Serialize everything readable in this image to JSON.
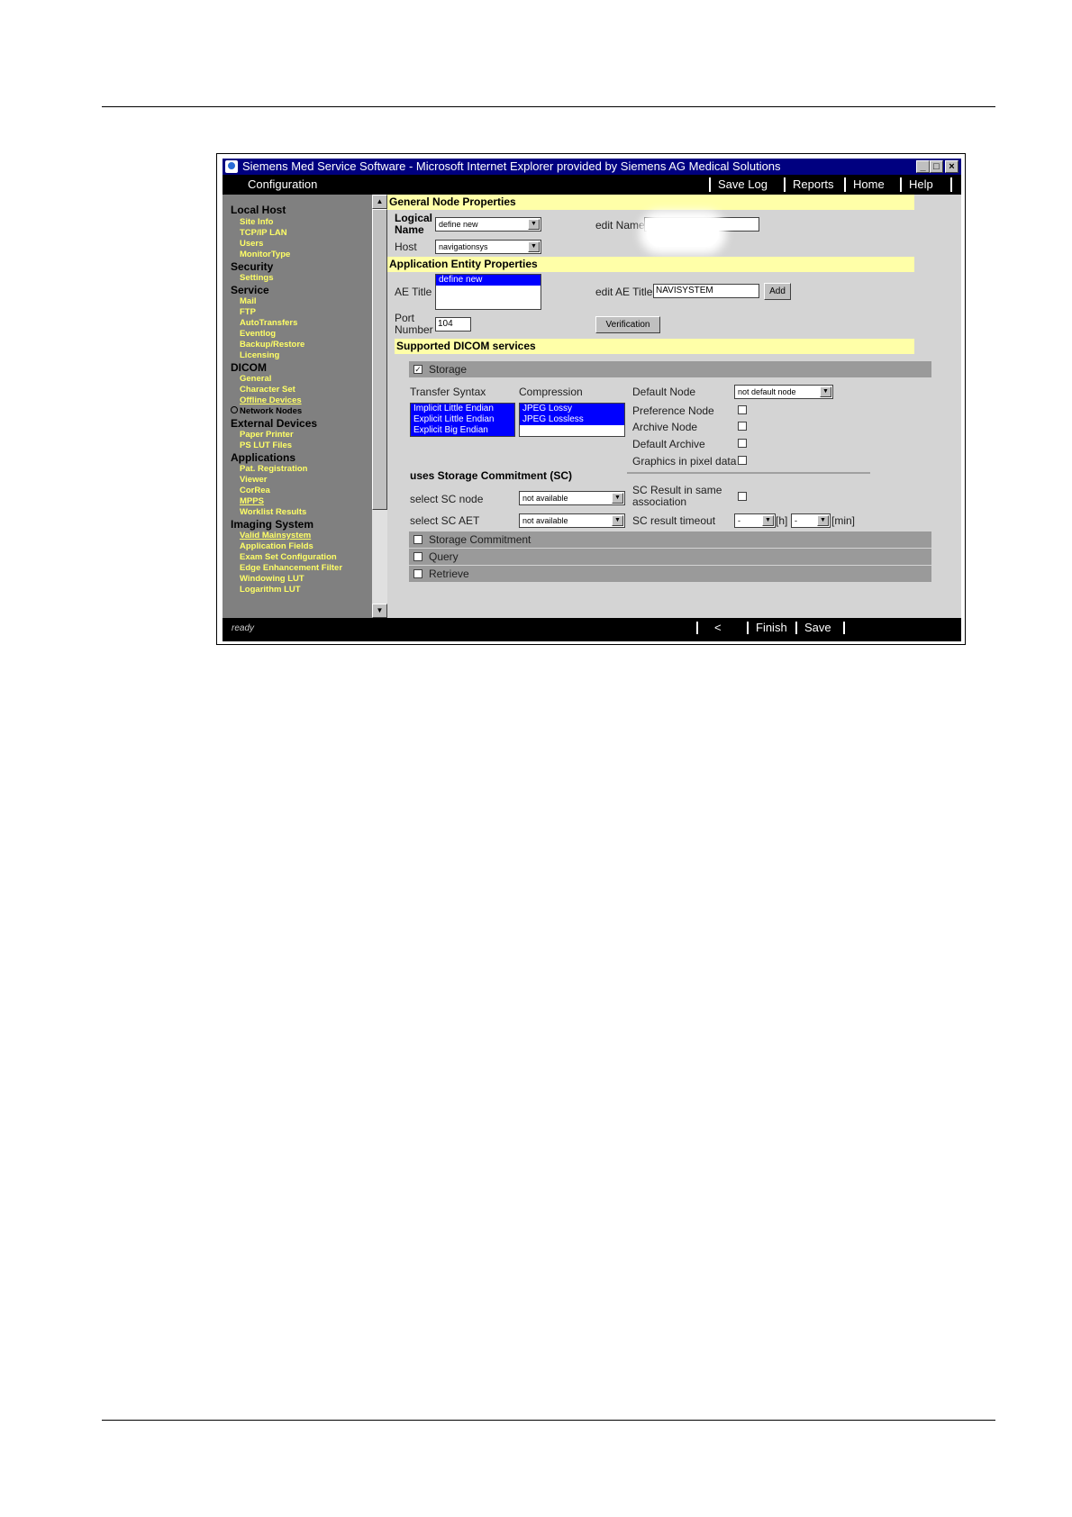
{
  "window": {
    "title": "Siemens Med Service Software - Microsoft Internet Explorer provided by Siemens AG Medical Solutions",
    "min": "_",
    "max": "□",
    "close": "×"
  },
  "topnav": {
    "section": "Configuration",
    "links": [
      "Save Log",
      "Reports",
      "Home",
      "Help"
    ]
  },
  "sidebar": {
    "groups": [
      {
        "title": "Local Host",
        "items": [
          "Site Info",
          "TCP/IP LAN",
          "Users",
          "MonitorType"
        ]
      },
      {
        "title": "Security",
        "items": [
          "Settings"
        ]
      },
      {
        "title": "Service",
        "items": [
          "Mail",
          "FTP",
          "AutoTransfers",
          "Eventlog",
          "Backup/Restore",
          "Licensing"
        ]
      },
      {
        "title": "DICOM",
        "items": [
          "General",
          "Character Set",
          "Offline Devices",
          "Network Nodes"
        ]
      },
      {
        "title": "External Devices",
        "items": [
          "Paper Printer",
          "PS LUT Files"
        ]
      },
      {
        "title": "Applications",
        "items": [
          "Pat. Registration",
          "Viewer",
          "CorRea",
          "MPPS",
          "Worklist Results"
        ]
      },
      {
        "title": "Imaging System",
        "items": [
          "Valid Mainsystem",
          "Application Fields",
          "Exam Set Configuration",
          "Edge Enhancement Filter",
          "Windowing LUT",
          "Logarithm LUT"
        ]
      }
    ]
  },
  "general": {
    "title": "General Node Properties",
    "logical_name_label": "Logical Name",
    "logical_name_value": "define new",
    "edit_name_label": "edit Name",
    "host_label": "Host",
    "host_value": "navigationsys"
  },
  "ae": {
    "title": "Application Entity Properties",
    "ae_title_label": "AE Title",
    "ae_list": [
      "define new"
    ],
    "edit_ae_label": "edit AE Title",
    "edit_ae_value": "NAVISYSTEM",
    "add_button": "Add",
    "port_label": "Port Number",
    "port_value": "104",
    "verification_button": "Verification"
  },
  "dicom": {
    "title": "Supported DICOM services",
    "storage": {
      "label": "Storage",
      "checked": true,
      "transfer_syntax_label": "Transfer Syntax",
      "transfer_syntax": [
        "Implicit Little Endian",
        "Explicit Little Endian",
        "Explicit Big Endian"
      ],
      "compression_label": "Compression",
      "compression": [
        "JPEG Lossy",
        "JPEG Lossless"
      ],
      "default_node_label": "Default Node",
      "default_node_value": "not default node",
      "preference_node_label": "Preference Node",
      "archive_node_label": "Archive Node",
      "default_archive_label": "Default Archive",
      "graphics_label": "Graphics in pixel data",
      "sc_title": "uses Storage Commitment (SC)",
      "sc_node_label": "select SC node",
      "sc_node_value": "not available",
      "sc_aet_label": "select SC AET",
      "sc_aet_value": "not available",
      "sc_result_label": "SC Result in same association",
      "sc_timeout_label": "SC result timeout",
      "timeout_h_value": "-",
      "timeout_h_unit": "[h]",
      "timeout_min_value": "-",
      "timeout_min_unit": "[min]"
    },
    "others": [
      "Storage Commitment",
      "Query",
      "Retrieve"
    ]
  },
  "status": {
    "text": "ready",
    "links": [
      "<",
      "Finish",
      "Save"
    ]
  },
  "colors": {
    "title_bar": "#000080",
    "section_header": "#ffffa8",
    "sidebar_link": "#ffff66",
    "selection": "#0000ff"
  }
}
